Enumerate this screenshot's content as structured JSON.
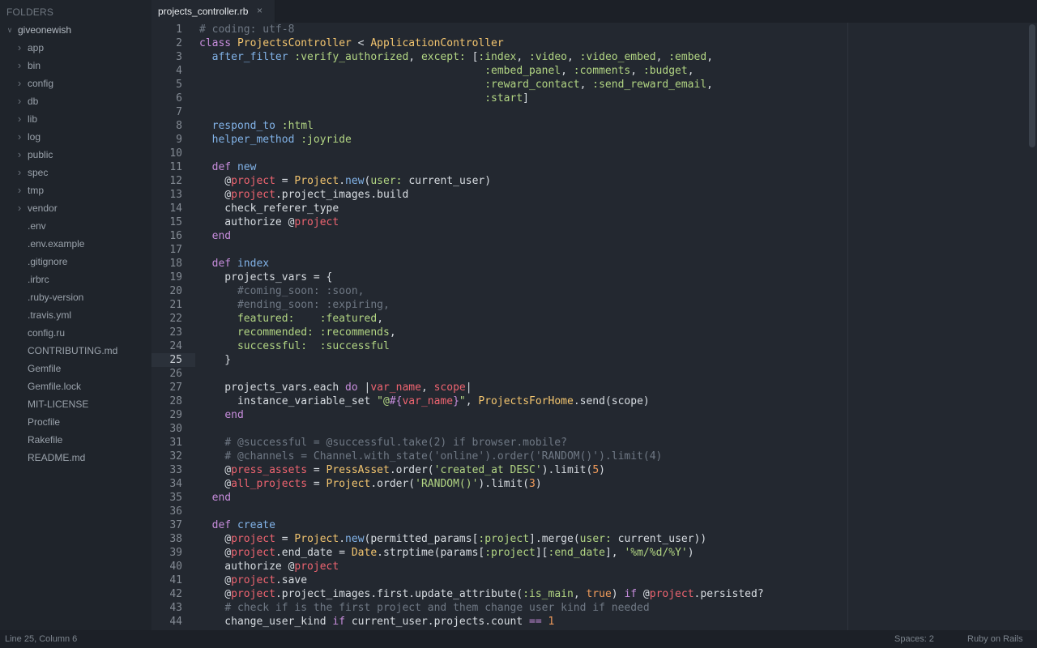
{
  "sidebar": {
    "header": "FOLDERS",
    "tree": [
      {
        "label": "giveonewish",
        "type": "folder-open",
        "depth": 0
      },
      {
        "label": "app",
        "type": "folder",
        "depth": 1
      },
      {
        "label": "bin",
        "type": "folder",
        "depth": 1
      },
      {
        "label": "config",
        "type": "folder",
        "depth": 1
      },
      {
        "label": "db",
        "type": "folder",
        "depth": 1
      },
      {
        "label": "lib",
        "type": "folder",
        "depth": 1
      },
      {
        "label": "log",
        "type": "folder",
        "depth": 1
      },
      {
        "label": "public",
        "type": "folder",
        "depth": 1
      },
      {
        "label": "spec",
        "type": "folder",
        "depth": 1
      },
      {
        "label": "tmp",
        "type": "folder",
        "depth": 1
      },
      {
        "label": "vendor",
        "type": "folder",
        "depth": 1
      },
      {
        "label": ".env",
        "type": "file",
        "depth": 1
      },
      {
        "label": ".env.example",
        "type": "file",
        "depth": 1
      },
      {
        "label": ".gitignore",
        "type": "file",
        "depth": 1
      },
      {
        "label": ".irbrc",
        "type": "file",
        "depth": 1
      },
      {
        "label": ".ruby-version",
        "type": "file",
        "depth": 1
      },
      {
        "label": ".travis.yml",
        "type": "file",
        "depth": 1
      },
      {
        "label": "config.ru",
        "type": "file",
        "depth": 1
      },
      {
        "label": "CONTRIBUTING.md",
        "type": "file",
        "depth": 1
      },
      {
        "label": "Gemfile",
        "type": "file",
        "depth": 1
      },
      {
        "label": "Gemfile.lock",
        "type": "file",
        "depth": 1
      },
      {
        "label": "MIT-LICENSE",
        "type": "file",
        "depth": 1
      },
      {
        "label": "Procfile",
        "type": "file",
        "depth": 1
      },
      {
        "label": "Rakefile",
        "type": "file",
        "depth": 1
      },
      {
        "label": "README.md",
        "type": "file",
        "depth": 1
      }
    ]
  },
  "tabs": [
    {
      "label": "projects_controller.rb",
      "close_icon": "×",
      "active": true
    }
  ],
  "editor": {
    "active_line": 25,
    "lines": [
      [
        [
          "c",
          "# coding: utf-8"
        ]
      ],
      [
        [
          "k",
          "class "
        ],
        [
          "cls",
          "ProjectsController"
        ],
        [
          "p",
          " < "
        ],
        [
          "cls",
          "ApplicationController"
        ]
      ],
      [
        [
          "p",
          "  "
        ],
        [
          "fn",
          "after_filter"
        ],
        [
          "p",
          " "
        ],
        [
          "sym",
          ":verify_authorized"
        ],
        [
          "p",
          ", "
        ],
        [
          "sym",
          "except:"
        ],
        [
          "p",
          " ["
        ],
        [
          "sym",
          ":index"
        ],
        [
          "p",
          ", "
        ],
        [
          "sym",
          ":video"
        ],
        [
          "p",
          ", "
        ],
        [
          "sym",
          ":video_embed"
        ],
        [
          "p",
          ", "
        ],
        [
          "sym",
          ":embed"
        ],
        [
          "p",
          ","
        ]
      ],
      [
        [
          "p",
          "                                             "
        ],
        [
          "sym",
          ":embed_panel"
        ],
        [
          "p",
          ", "
        ],
        [
          "sym",
          ":comments"
        ],
        [
          "p",
          ", "
        ],
        [
          "sym",
          ":budget"
        ],
        [
          "p",
          ","
        ]
      ],
      [
        [
          "p",
          "                                             "
        ],
        [
          "sym",
          ":reward_contact"
        ],
        [
          "p",
          ", "
        ],
        [
          "sym",
          ":send_reward_email"
        ],
        [
          "p",
          ","
        ]
      ],
      [
        [
          "p",
          "                                             "
        ],
        [
          "sym",
          ":start"
        ],
        [
          "p",
          "]"
        ]
      ],
      [
        [
          "p",
          ""
        ]
      ],
      [
        [
          "p",
          "  "
        ],
        [
          "fn",
          "respond_to"
        ],
        [
          "p",
          " "
        ],
        [
          "sym",
          ":html"
        ]
      ],
      [
        [
          "p",
          "  "
        ],
        [
          "fn",
          "helper_method"
        ],
        [
          "p",
          " "
        ],
        [
          "sym",
          ":joyride"
        ]
      ],
      [
        [
          "p",
          ""
        ]
      ],
      [
        [
          "p",
          "  "
        ],
        [
          "k",
          "def "
        ],
        [
          "fn",
          "new"
        ]
      ],
      [
        [
          "p",
          "    @"
        ],
        [
          "iv",
          "project"
        ],
        [
          "p",
          " = "
        ],
        [
          "cls",
          "Project"
        ],
        [
          "p",
          "."
        ],
        [
          "fn",
          "new"
        ],
        [
          "p",
          "("
        ],
        [
          "sym",
          "user:"
        ],
        [
          "p",
          " current_user)"
        ]
      ],
      [
        [
          "p",
          "    @"
        ],
        [
          "iv",
          "project"
        ],
        [
          "p",
          ".project_images.build"
        ]
      ],
      [
        [
          "p",
          "    check_referer_type"
        ]
      ],
      [
        [
          "p",
          "    authorize @"
        ],
        [
          "iv",
          "project"
        ]
      ],
      [
        [
          "p",
          "  "
        ],
        [
          "k",
          "end"
        ]
      ],
      [
        [
          "p",
          ""
        ]
      ],
      [
        [
          "p",
          "  "
        ],
        [
          "k",
          "def "
        ],
        [
          "fn",
          "index"
        ]
      ],
      [
        [
          "p",
          "    projects_vars = {"
        ]
      ],
      [
        [
          "p",
          "      "
        ],
        [
          "c",
          "#coming_soon: :soon,"
        ]
      ],
      [
        [
          "p",
          "      "
        ],
        [
          "c",
          "#ending_soon: :expiring,"
        ]
      ],
      [
        [
          "p",
          "      "
        ],
        [
          "sym",
          "featured:"
        ],
        [
          "p",
          "    "
        ],
        [
          "sym",
          ":featured"
        ],
        [
          "p",
          ","
        ]
      ],
      [
        [
          "p",
          "      "
        ],
        [
          "sym",
          "recommended:"
        ],
        [
          "p",
          " "
        ],
        [
          "sym",
          ":recommends"
        ],
        [
          "p",
          ","
        ]
      ],
      [
        [
          "p",
          "      "
        ],
        [
          "sym",
          "successful:"
        ],
        [
          "p",
          "  "
        ],
        [
          "sym",
          ":successful"
        ]
      ],
      [
        [
          "p",
          "    }"
        ]
      ],
      [
        [
          "p",
          ""
        ]
      ],
      [
        [
          "p",
          "    projects_vars.each "
        ],
        [
          "k",
          "do"
        ],
        [
          "p",
          " |"
        ],
        [
          "iv",
          "var_name"
        ],
        [
          "p",
          ", "
        ],
        [
          "iv",
          "scope"
        ],
        [
          "p",
          "|"
        ]
      ],
      [
        [
          "p",
          "      instance_variable_set "
        ],
        [
          "s",
          "\"@"
        ],
        [
          "k",
          "#{"
        ],
        [
          "iv",
          "var_name"
        ],
        [
          "k",
          "}"
        ],
        [
          "s",
          "\""
        ],
        [
          "p",
          ", "
        ],
        [
          "cls",
          "ProjectsForHome"
        ],
        [
          "p",
          ".send(scope)"
        ]
      ],
      [
        [
          "p",
          "    "
        ],
        [
          "k",
          "end"
        ]
      ],
      [
        [
          "p",
          ""
        ]
      ],
      [
        [
          "p",
          "    "
        ],
        [
          "c",
          "# @successful = @successful.take(2) if browser.mobile?"
        ]
      ],
      [
        [
          "p",
          "    "
        ],
        [
          "c",
          "# @channels = Channel.with_state('online').order('RANDOM()').limit(4)"
        ]
      ],
      [
        [
          "p",
          "    @"
        ],
        [
          "iv",
          "press_assets"
        ],
        [
          "p",
          " = "
        ],
        [
          "cls",
          "PressAsset"
        ],
        [
          "p",
          ".order("
        ],
        [
          "s",
          "'created_at DESC'"
        ],
        [
          "p",
          ").limit("
        ],
        [
          "n",
          "5"
        ],
        [
          "p",
          ")"
        ]
      ],
      [
        [
          "p",
          "    @"
        ],
        [
          "iv",
          "all_projects"
        ],
        [
          "p",
          " = "
        ],
        [
          "cls",
          "Project"
        ],
        [
          "p",
          ".order("
        ],
        [
          "s",
          "'RANDOM()'"
        ],
        [
          "p",
          ").limit("
        ],
        [
          "n",
          "3"
        ],
        [
          "p",
          ")"
        ]
      ],
      [
        [
          "p",
          "  "
        ],
        [
          "k",
          "end"
        ]
      ],
      [
        [
          "p",
          ""
        ]
      ],
      [
        [
          "p",
          "  "
        ],
        [
          "k",
          "def "
        ],
        [
          "fn",
          "create"
        ]
      ],
      [
        [
          "p",
          "    @"
        ],
        [
          "iv",
          "project"
        ],
        [
          "p",
          " = "
        ],
        [
          "cls",
          "Project"
        ],
        [
          "p",
          "."
        ],
        [
          "fn",
          "new"
        ],
        [
          "p",
          "(permitted_params["
        ],
        [
          "sym",
          ":project"
        ],
        [
          "p",
          "].merge("
        ],
        [
          "sym",
          "user:"
        ],
        [
          "p",
          " current_user))"
        ]
      ],
      [
        [
          "p",
          "    @"
        ],
        [
          "iv",
          "project"
        ],
        [
          "p",
          ".end_date = "
        ],
        [
          "cls",
          "Date"
        ],
        [
          "p",
          ".strptime(params["
        ],
        [
          "sym",
          ":project"
        ],
        [
          "p",
          "]["
        ],
        [
          "sym",
          ":end_date"
        ],
        [
          "p",
          "], "
        ],
        [
          "s",
          "'%m/%d/%Y'"
        ],
        [
          "p",
          ")"
        ]
      ],
      [
        [
          "p",
          "    authorize @"
        ],
        [
          "iv",
          "project"
        ]
      ],
      [
        [
          "p",
          "    @"
        ],
        [
          "iv",
          "project"
        ],
        [
          "p",
          ".save"
        ]
      ],
      [
        [
          "p",
          "    @"
        ],
        [
          "iv",
          "project"
        ],
        [
          "p",
          ".project_images.first.update_attribute("
        ],
        [
          "sym",
          ":is_main"
        ],
        [
          "p",
          ", "
        ],
        [
          "n",
          "true"
        ],
        [
          "p",
          ") "
        ],
        [
          "k",
          "if"
        ],
        [
          "p",
          " @"
        ],
        [
          "iv",
          "project"
        ],
        [
          "p",
          ".persisted?"
        ]
      ],
      [
        [
          "p",
          "    "
        ],
        [
          "c",
          "# check if is the first project and them change user kind if needed"
        ]
      ],
      [
        [
          "p",
          "    change_user_kind "
        ],
        [
          "k",
          "if"
        ],
        [
          "p",
          " current_user.projects.count "
        ],
        [
          "k",
          "=="
        ],
        [
          "p",
          " "
        ],
        [
          "n",
          "1"
        ]
      ]
    ]
  },
  "statusbar": {
    "position": "Line 25, Column 6",
    "spaces": "Spaces: 2",
    "syntax": "Ruby on Rails"
  },
  "colors": {
    "background": "#232830",
    "sidebar": "#1f242b",
    "comment": "#6f7884",
    "keyword": "#c78ddc",
    "class": "#f3c56f",
    "symbol": "#b2d583",
    "ivar": "#ee6470",
    "number": "#f09b5a"
  },
  "icons": {
    "folder_closed": "chevron-right-icon",
    "folder_open": "chevron-down-icon",
    "tab_close": "close-icon"
  }
}
